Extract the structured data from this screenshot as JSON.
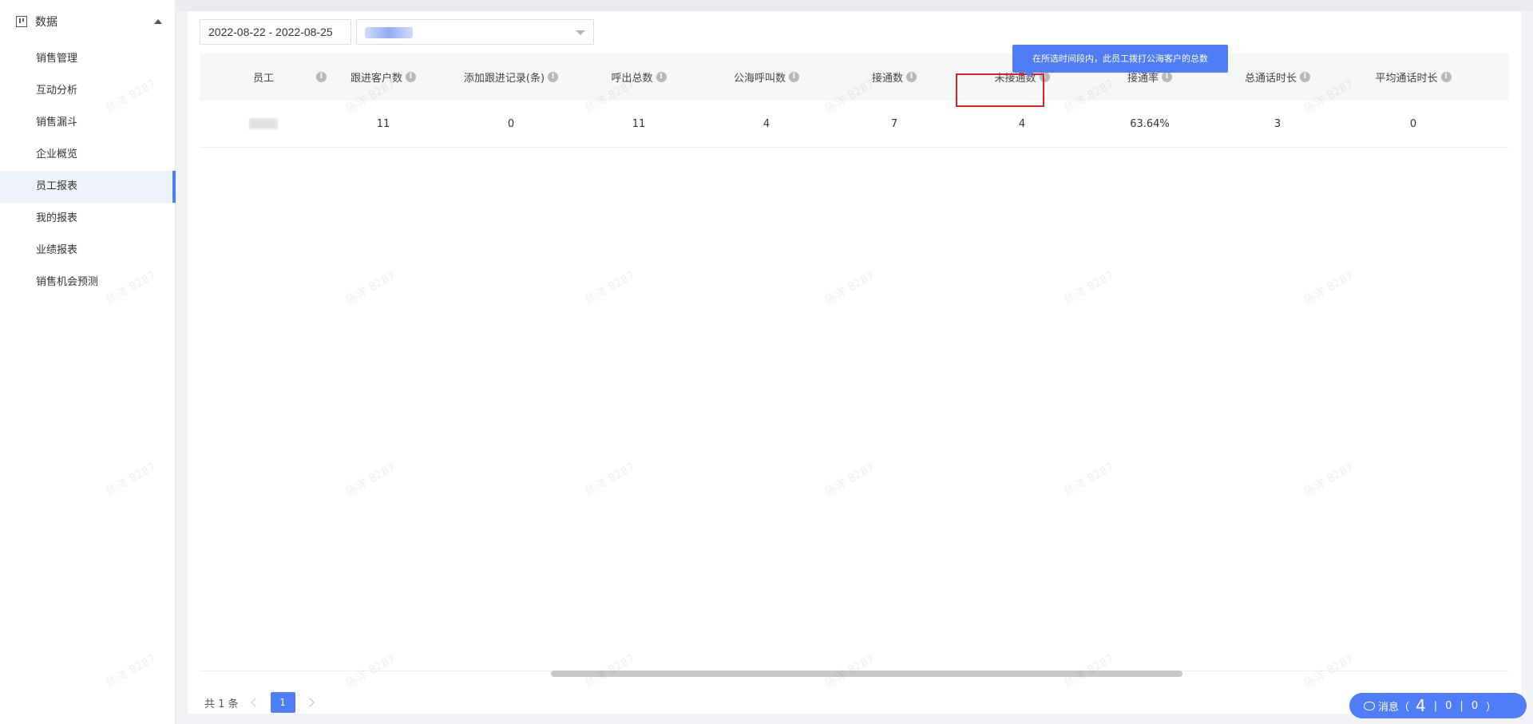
{
  "sidebar": {
    "section_title": "数据",
    "items": [
      {
        "label": "销售管理"
      },
      {
        "label": "互动分析"
      },
      {
        "label": "销售漏斗"
      },
      {
        "label": "企业概览"
      },
      {
        "label": "员工报表"
      },
      {
        "label": "我的报表"
      },
      {
        "label": "业绩报表"
      },
      {
        "label": "销售机会预测"
      }
    ]
  },
  "filters": {
    "date_range": "2022-08-22 - 2022-08-25"
  },
  "tooltip": "在所选时间段内，此员工拨打公海客户的总数",
  "table": {
    "headers": [
      "员工",
      "",
      "跟进客户数",
      "添加跟进记录(条)",
      "呼出总数",
      "公海呼叫数",
      "接通数",
      "未接通数",
      "接通率",
      "总通话时长",
      "平均通话时长"
    ],
    "rows": [
      {
        "values": [
          "",
          "11",
          "0",
          "11",
          "4",
          "7",
          "4",
          "63.64%",
          "3",
          "0"
        ]
      }
    ]
  },
  "pagination": {
    "total": "共 1 条",
    "current_page": "1"
  },
  "message": {
    "label": "消息（",
    "count_a": "4",
    "sep1": "|",
    "count_b": "0",
    "sep2": "|",
    "count_c": "0",
    "close": "）"
  },
  "watermark": "陈洋 8287",
  "colors": {
    "accent": "#4f7cf7",
    "highlight": "#e02020"
  }
}
